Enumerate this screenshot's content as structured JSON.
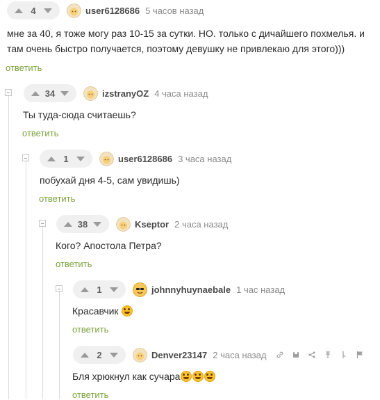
{
  "reply_label": "ответить",
  "accent_color": "#7aa13a",
  "comments": [
    {
      "votes": "4",
      "user": "user6128686",
      "time": "5 часов назад",
      "text": "мне за 40, я тоже могу раз 10-15 за сутки. НО. только с дичайшего похмелья. и там очень быстро получается, поэтому девушку не привлекаю для этого)))",
      "emoji_count": 0
    },
    {
      "votes": "34",
      "user": "izstranyOZ",
      "time": "4 часа назад",
      "text": "Ты туда-сюда считаешь?",
      "emoji_count": 0
    },
    {
      "votes": "1",
      "user": "user6128686",
      "time": "3 часа назад",
      "text": "побухай дня 4-5, сам увидишь)",
      "emoji_count": 0
    },
    {
      "votes": "38",
      "user": "Kseptor",
      "time": "2 часа назад",
      "text": "Кого? Апостола Петра?",
      "emoji_count": 0
    },
    {
      "votes": "1",
      "user": "johnnyhuynaebale",
      "time": "1 час назад",
      "text": "Красавчик",
      "emoji_count": 1,
      "emoji": "rofl-emoji"
    },
    {
      "votes": "2",
      "user": "Denver23147",
      "time": "2 часа назад",
      "text": "Бля хрюкнул как сучара",
      "emoji_count": 3,
      "emoji": "rofl-emoji",
      "tools": [
        "link-icon",
        "save-icon",
        "share-icon",
        "upvote-parent-icon",
        "branch-icon",
        "report-flag-icon"
      ]
    }
  ]
}
